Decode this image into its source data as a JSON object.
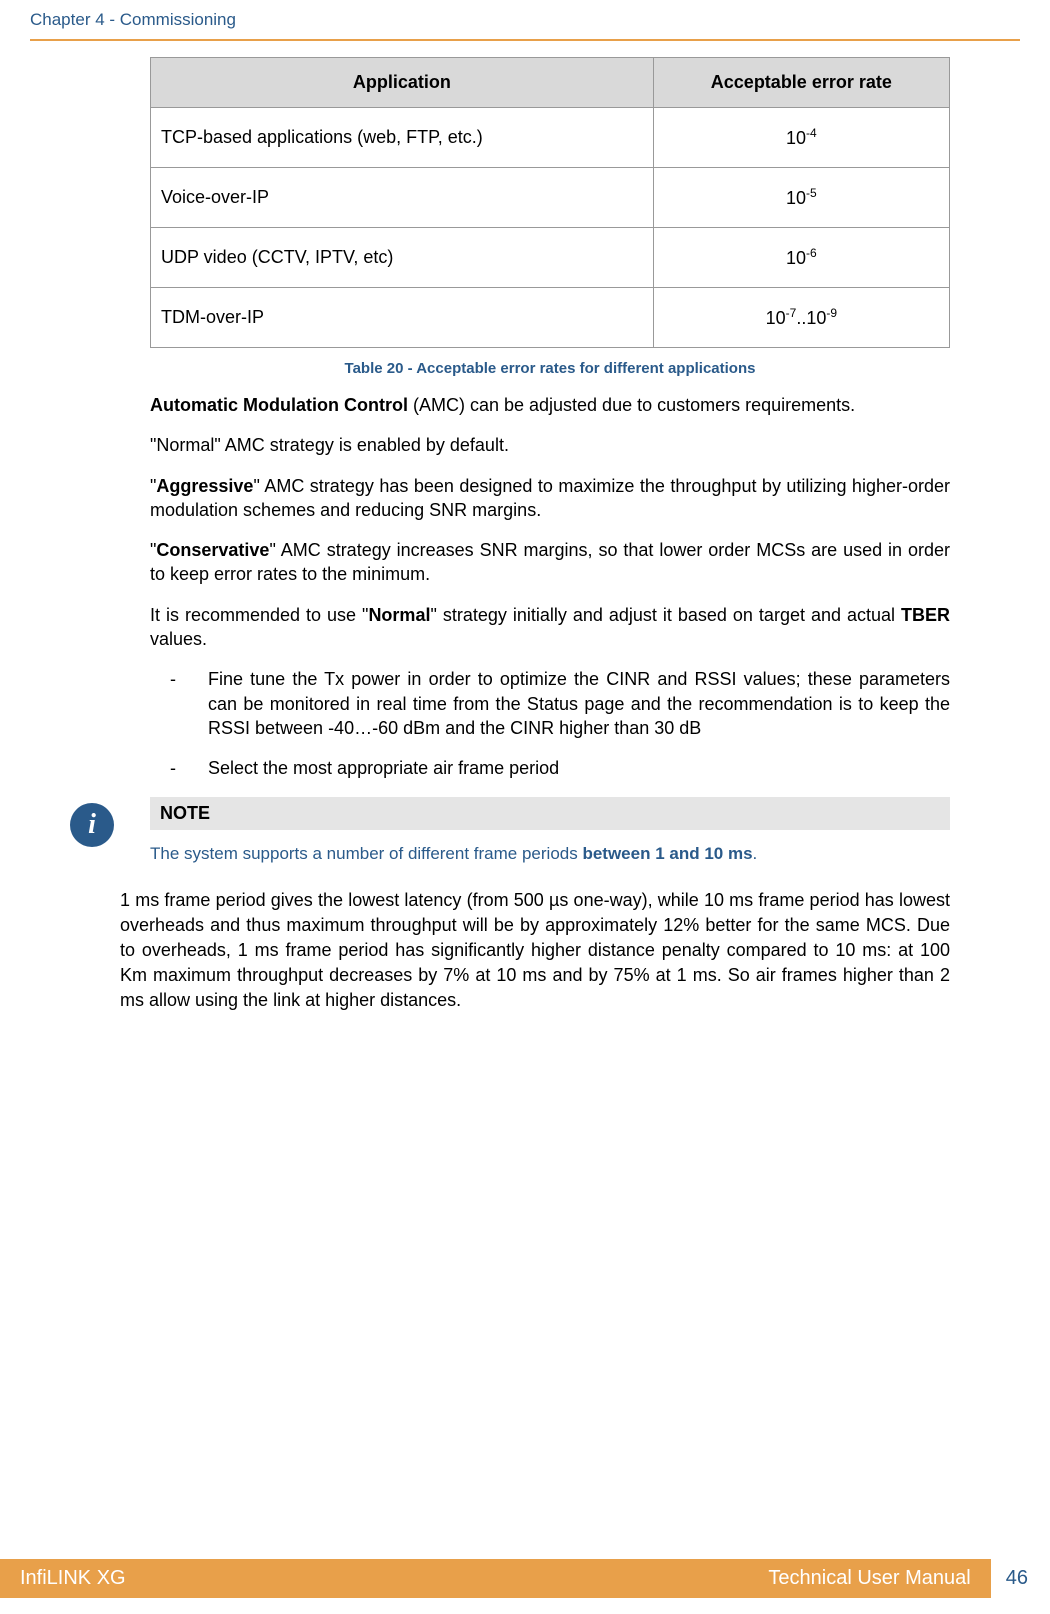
{
  "header": {
    "chapter": "Chapter 4 - Commissioning"
  },
  "table": {
    "col1": "Application",
    "col2": "Acceptable error rate",
    "rows": [
      {
        "app": "TCP-based applications (web, FTP, etc.)",
        "rate_base": "10",
        "rate_exp": "-4"
      },
      {
        "app": "Voice-over-IP",
        "rate_base": "10",
        "rate_exp": "-5"
      },
      {
        "app": "UDP video (CCTV, IPTV, etc)",
        "rate_base": "10",
        "rate_exp": "-6"
      },
      {
        "app": "TDM-over-IP",
        "rate_base": "10",
        "rate_exp1": "-7",
        "mid": "..10",
        "rate_exp2": "-9"
      }
    ],
    "caption": "Table 20 - Acceptable error rates for different applications"
  },
  "p1": {
    "b1": "Automatic Modulation Control",
    "t1": " (AMC) can be adjusted due to customers requirements."
  },
  "p2": "\"Normal\" AMC strategy is enabled by default.",
  "p3": {
    "t1": "\"",
    "b1": "Aggressive",
    "t2": "\" AMC strategy has been designed to maximize the throughput by utilizing higher-order modulation schemes and reducing SNR margins."
  },
  "p4": {
    "t1": "\"",
    "b1": "Conservative",
    "t2": "\" AMC strategy increases SNR margins, so that lower order MCSs are used in order to keep error rates to the minimum."
  },
  "p5": {
    "t1": "It is recommended to use \"",
    "b1": "Normal",
    "t2": "\" strategy initially and adjust it based on target and actual ",
    "b2": "TBER",
    "t3": " values."
  },
  "bullets": {
    "b1": "Fine tune the Tx power in order to optimize the CINR and RSSI values; these parameters can be monitored in real time from the Status page and the recommendation is to keep the RSSI between -40…-60 dBm and the CINR higher than 30 dB",
    "b2": "Select the most appropriate air frame period"
  },
  "note": {
    "title": "NOTE",
    "t1": "The system supports a number of different frame periods ",
    "b1": "between 1 and 10 ms",
    "t2": "."
  },
  "p6": "1 ms frame period gives the lowest latency (from 500 µs one-way), while 10 ms frame period has lowest overheads and thus maximum throughput will be by approximately 12% better for the same MCS. Due to overheads, 1 ms frame period has significantly higher distance penalty compared to 10 ms: at 100 Km maximum throughput decreases by 7% at 10 ms and by 75% at 1 ms. So air frames higher than 2 ms allow using the link at higher distances.",
  "footer": {
    "product": "InfiLINK XG",
    "doc": "Technical User Manual",
    "page": "46"
  }
}
